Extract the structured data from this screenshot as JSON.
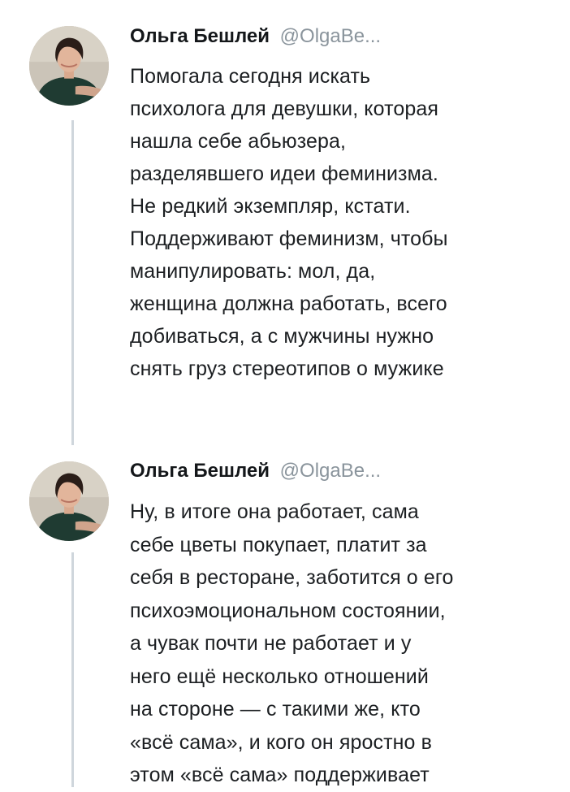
{
  "tweets": [
    {
      "author_name": "Ольга Бешлей",
      "author_handle": "@OlgaBe...",
      "avatar_icon": "profile-photo",
      "lines": [
        "Помогала сегодня искать",
        "психолога для девушки, которая",
        "нашла себе абьюзера,",
        "разделявшего идеи феминизма.",
        "Не редкий экземпляр, кстати.",
        "Поддерживают феминизм, чтобы",
        "манипулировать: мол, да,",
        "женщина должна работать, всего",
        "добиваться, а с мужчины нужно",
        "снять груз стереотипов о мужике"
      ]
    },
    {
      "author_name": "Ольга Бешлей",
      "author_handle": "@OlgaBe...",
      "avatar_icon": "profile-photo",
      "lines": [
        "Ну, в итоге она работает, сама",
        "себе цветы покупает, платит за",
        "себя в ресторане, заботится о его",
        "психоэмоциональном состоянии,",
        "а чувак почти не работает и у",
        "него ещё несколько отношений",
        "на стороне — с такими же, кто",
        "«всё сама», и кого он яростно в",
        "этом «всё сама» поддерживает"
      ]
    }
  ],
  "colors": {
    "text": "#1c1f22",
    "handle": "#8a949c",
    "thread_line": "#cfd6dc",
    "background": "#ffffff"
  }
}
